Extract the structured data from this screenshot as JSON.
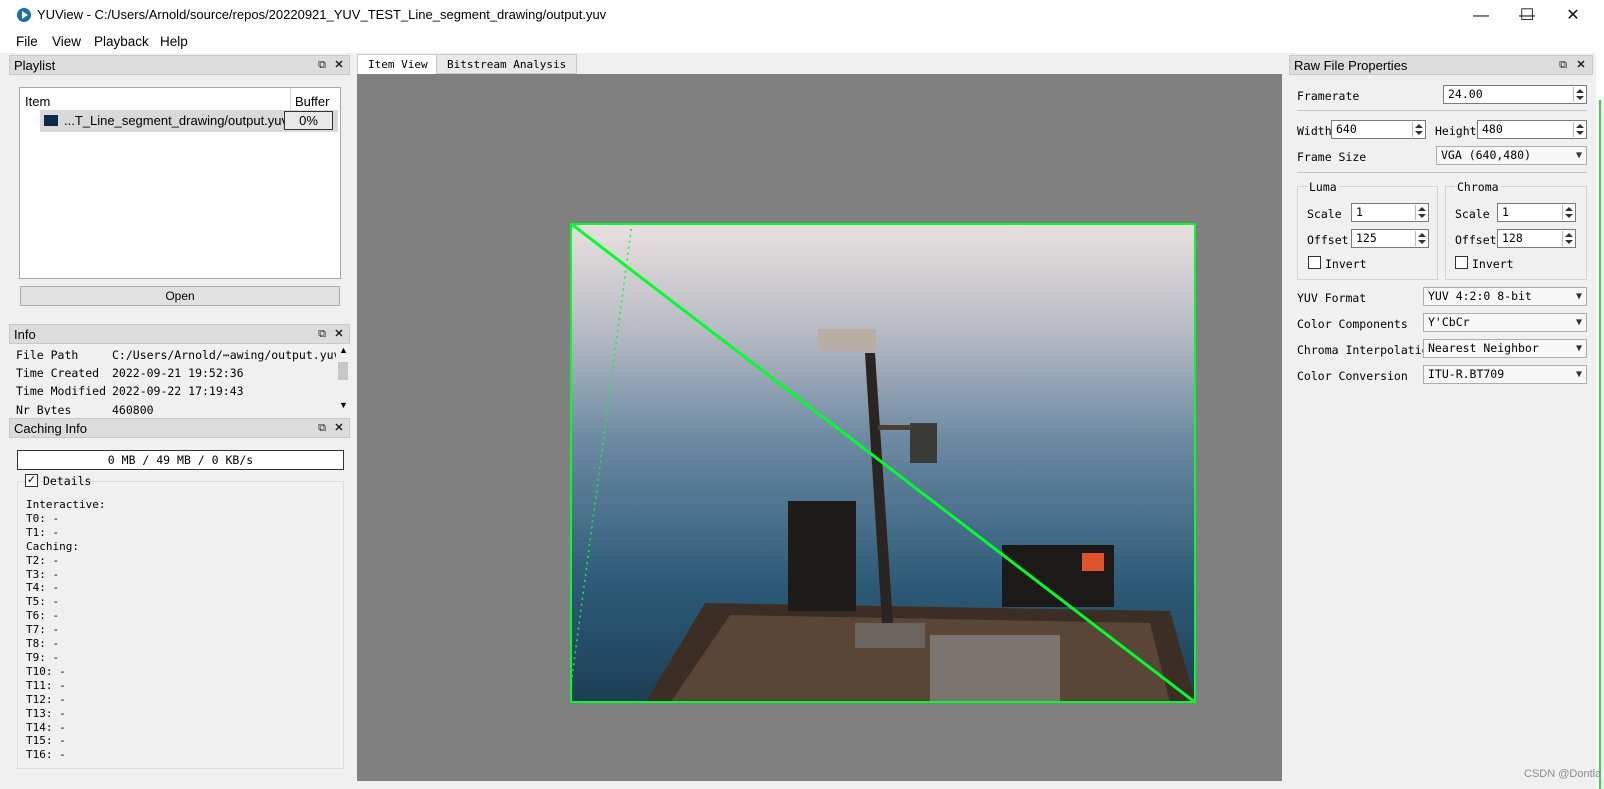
{
  "window": {
    "title": "YUView - C:/Users/Arnold/source/repos/20220921_YUV_TEST_Line_segment_drawing/output.yuv",
    "minimize_glyph": "—",
    "maximize_glyph": "☐",
    "close_glyph": "✕"
  },
  "menu": {
    "file": "File",
    "view": "View",
    "playback": "Playback",
    "help": "Help"
  },
  "playlist": {
    "title": "Playlist",
    "col_item": "Item",
    "col_buffer": "Buffer",
    "rows": [
      {
        "name": "...T_Line_segment_drawing/output.yuv",
        "buffer": "0%"
      }
    ],
    "open_label": "Open"
  },
  "info": {
    "title": "Info",
    "rows": [
      {
        "key": "File Path",
        "value": "C:/Users/Arnold/⋯awing/output.yuv"
      },
      {
        "key": "Time Created",
        "value": "2022-09-21 19:52:36"
      },
      {
        "key": "Time Modified",
        "value": "2022-09-22 17:19:43"
      },
      {
        "key": "Nr Bytes",
        "value": "460800"
      }
    ]
  },
  "caching": {
    "title": "Caching Info",
    "summary": "0 MB / 49 MB / 0 KB/s",
    "details_label": "Details",
    "details_checked": true,
    "lines": "Interactive:\nT0: -\nT1: -\nCaching:\nT2: -\nT3: -\nT4: -\nT5: -\nT6: -\nT7: -\nT8: -\nT9: -\nT10: -\nT11: -\nT12: -\nT13: -\nT14: -\nT15: -\nT16: -"
  },
  "tabs": {
    "item_view": "Item View",
    "bitstream_analysis": "Bitstream Analysis",
    "active": "Item View"
  },
  "raw_props": {
    "title": "Raw File Properties",
    "framerate_label": "Framerate",
    "framerate": "24.00",
    "width_label": "Width",
    "width": "640",
    "height_label": "Height",
    "height": "480",
    "frame_size_label": "Frame Size",
    "frame_size": "VGA (640,480)",
    "luma": {
      "title": "Luma",
      "scale_label": "Scale",
      "scale": "1",
      "offset_label": "Offset",
      "offset": "125",
      "invert_label": "Invert"
    },
    "chroma": {
      "title": "Chroma",
      "scale_label": "Scale",
      "scale": "1",
      "offset_label": "Offset",
      "offset": "128",
      "invert_label": "Invert"
    },
    "yuv_format_label": "YUV Format",
    "yuv_format": "YUV 4:2:0 8-bit",
    "color_components_label": "Color Components",
    "color_components": "Y'CbCr",
    "chroma_interp_label": "Chroma Interpolation",
    "chroma_interp": "Nearest Neighbor",
    "color_conversion_label": "Color Conversion",
    "color_conversion": "ITU-R.BT709"
  },
  "watermark": "CSDN @Dontla",
  "colors": {
    "overlay_line": "#00ff2a",
    "view_bg": "#808080"
  }
}
